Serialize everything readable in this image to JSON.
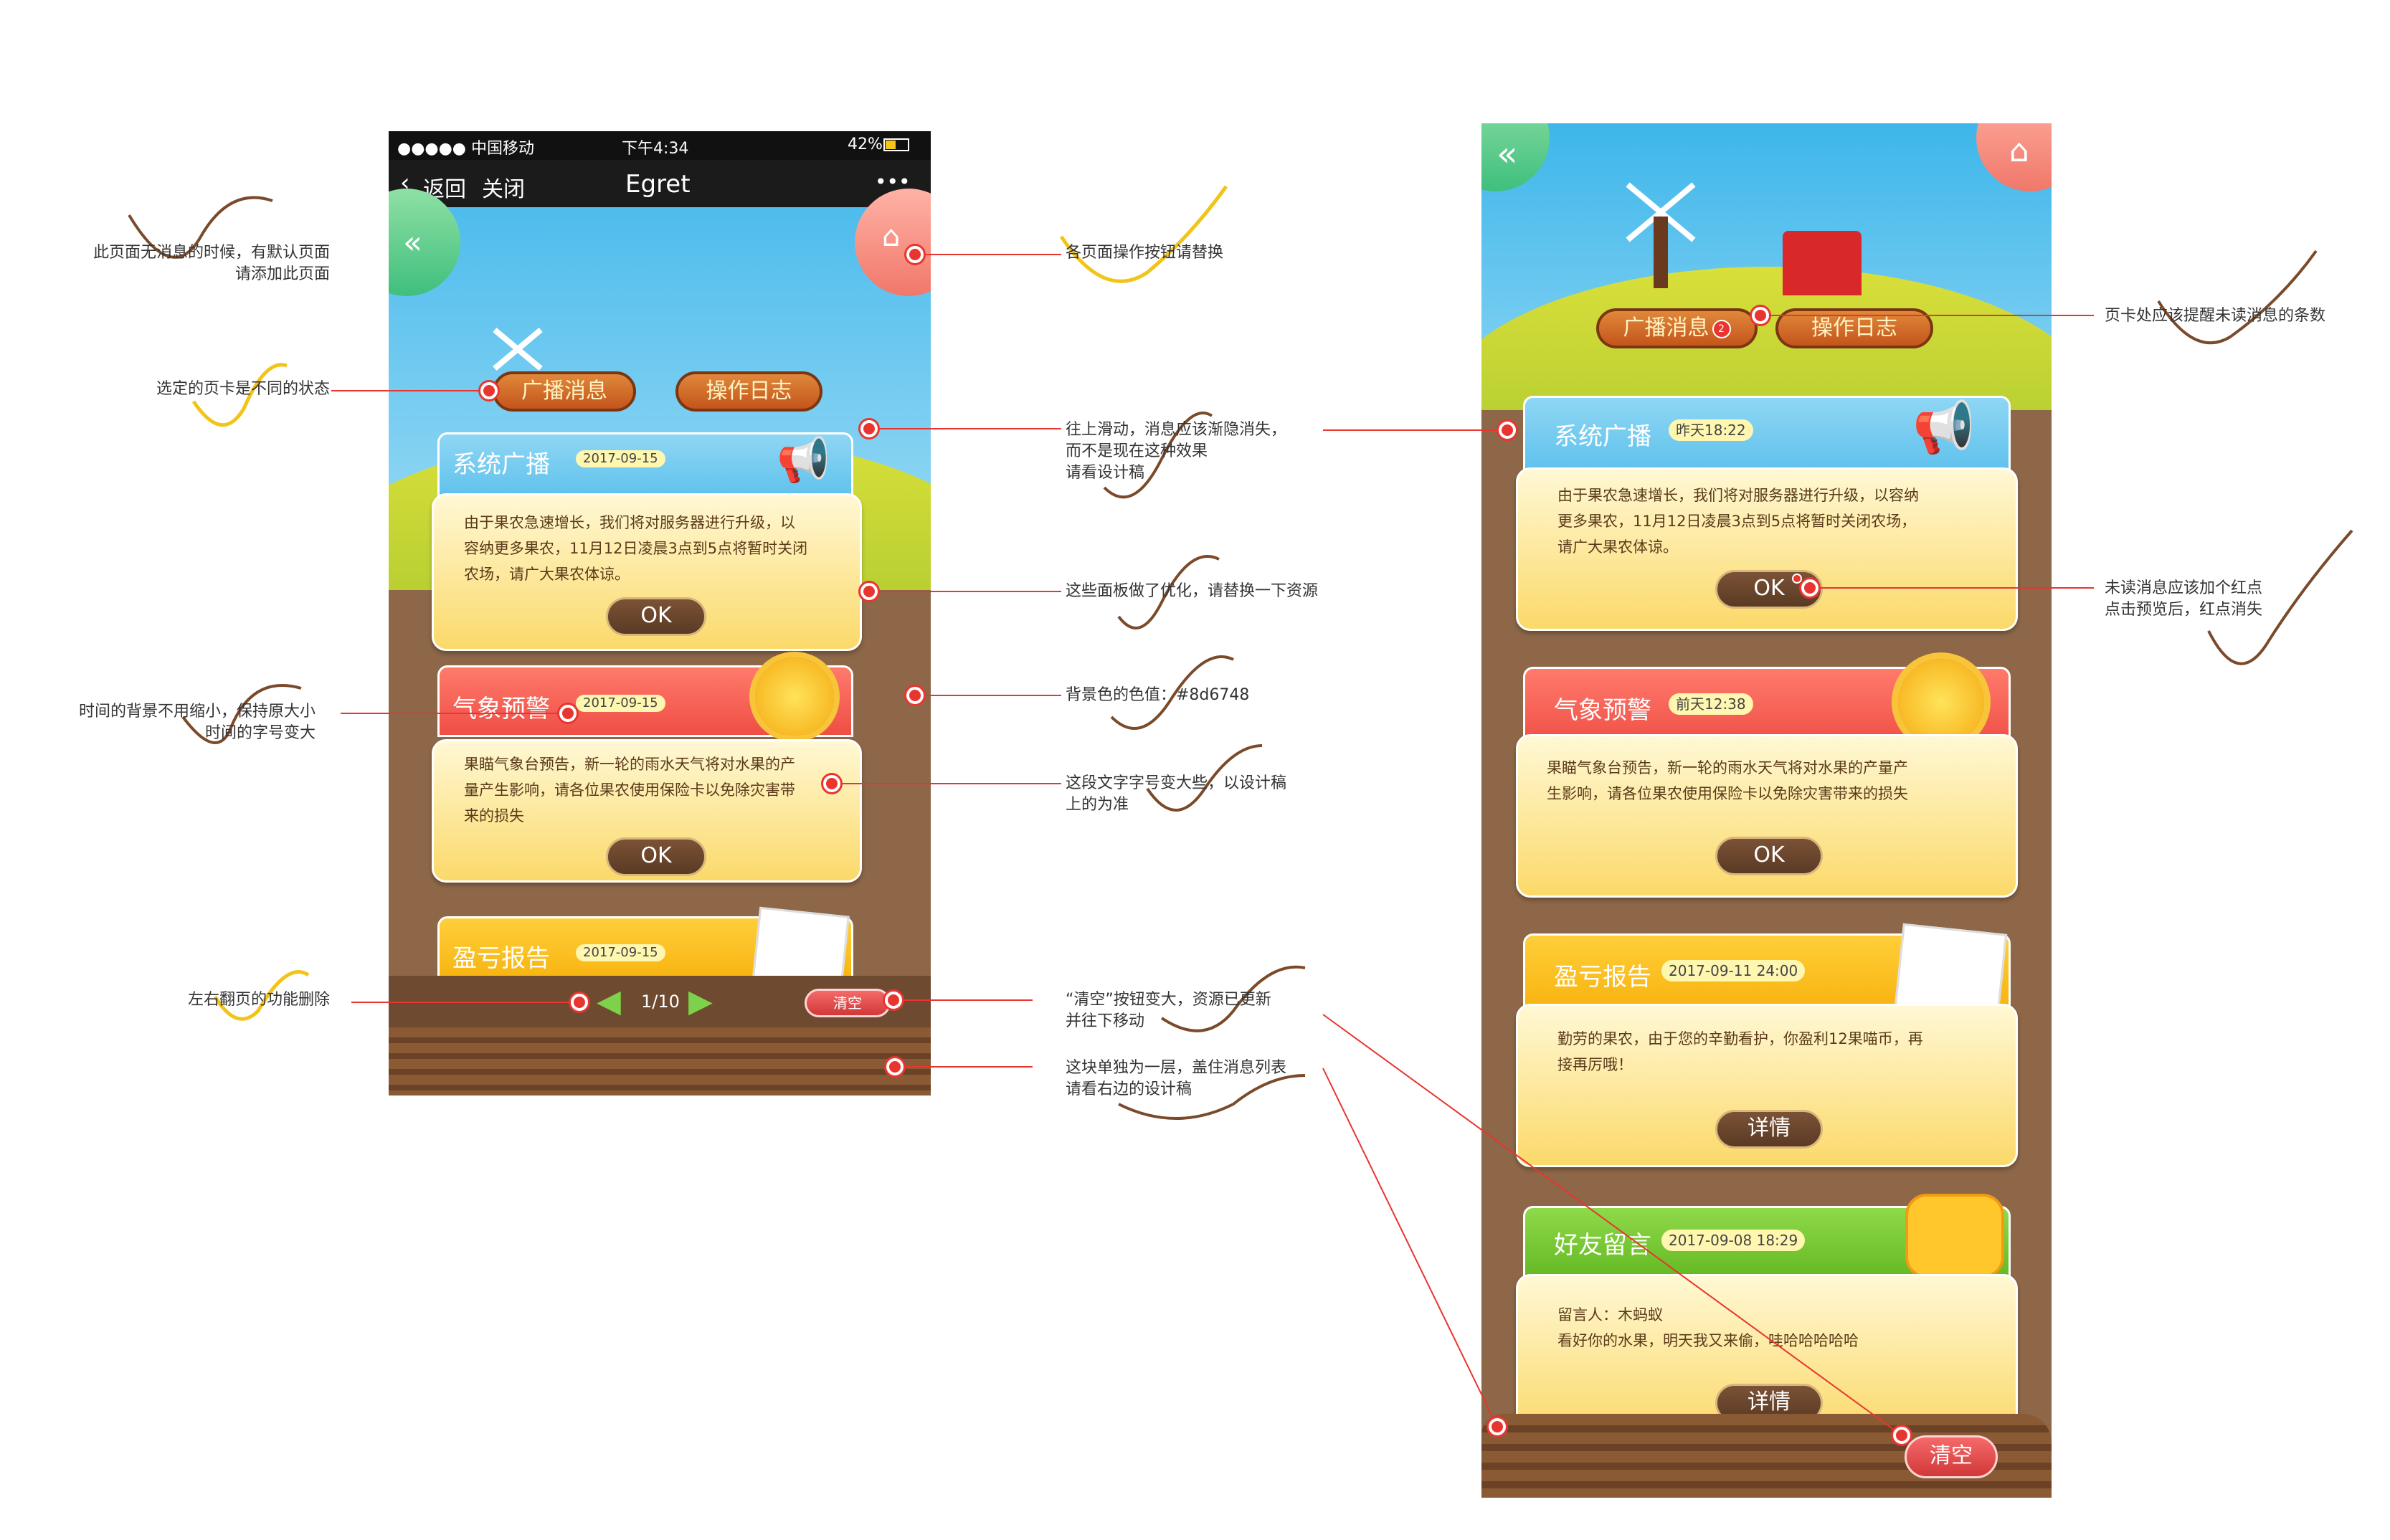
{
  "left_phone": {
    "status_bar": {
      "carrier": "●●●●● 中国移动",
      "time": "下午4:34",
      "battery": "42%"
    },
    "nav": {
      "back": "返回",
      "close": "关闭",
      "title": "Egret",
      "more": "•••"
    },
    "tabs": [
      "广播消息",
      "操作日志"
    ],
    "cards": [
      {
        "title": "系统广播",
        "time": "2017-09-15",
        "lines": [
          "由于果农急速增长，我们将对服务器进行升级，以",
          "容纳更多果农，11月12日凌晨3点到5点将暂时关闭",
          "农场，请广大果农体谅。"
        ],
        "button": "OK"
      },
      {
        "title": "气象预警",
        "time": "2017-09-15",
        "lines": [
          "果瞄气象台预告，新一轮的雨水天气将对水果的产",
          "量产生影响，请各位果农使用保险卡以免除灾害带",
          "来的损失"
        ],
        "button": "OK"
      },
      {
        "title": "盈亏报告",
        "time": "2017-09-15"
      }
    ],
    "pager": "1/10",
    "clear": "清空"
  },
  "right_phone": {
    "tabs": [
      "广播消息",
      "操作日志"
    ],
    "tab_badge": "2",
    "cards": [
      {
        "title": "系统广播",
        "time": "昨天18:22",
        "lines": [
          "由于果农急速增长，我们将对服务器进行升级，以容纳",
          "更多果农，11月12日凌晨3点到5点将暂时关闭农场，",
          "请广大果农体谅。"
        ],
        "button": "OK"
      },
      {
        "title": "气象预警",
        "time": "前天12:38",
        "lines": [
          "果瞄气象台预告，新一轮的雨水天气将对水果的产量产",
          "生影响，请各位果农使用保险卡以免除灾害带来的损失"
        ],
        "button": "OK"
      },
      {
        "title": "盈亏报告",
        "time": "2017-09-11 24:00",
        "lines": [
          "勤劳的果农，由于您的辛勤看护，你盈利12果喵币，再",
          "接再厉哦！"
        ],
        "button": "详情"
      },
      {
        "title": "好友留言",
        "time": "2017-09-08 18:29",
        "lines": [
          "留言人：木蚂蚁",
          "看好你的水果，明天我又来偷，哇哈哈哈哈哈"
        ],
        "button": "详情"
      }
    ],
    "clear": "清空"
  },
  "annotations": {
    "a1": [
      "此页面无消息的时候，有默认页面",
      "请添加此页面"
    ],
    "a2": "选定的页卡是不同的状态",
    "a3": [
      "时间的背景不用缩小，保持原大小",
      "时间的字号变大"
    ],
    "a4": "左右翻页的功能删除",
    "a5": "各页面操作按钮请替换",
    "a6": [
      "往上滑动，消息应该渐隐消失，",
      "而不是现在这种效果",
      "请看设计稿"
    ],
    "a7": "这些面板做了优化，请替换一下资源",
    "a8": "背景色的色值：#8d6748",
    "a9": [
      "这段文字字号变大些，以设计稿",
      "上的为准"
    ],
    "a10": [
      "“清空”按钮变大，资源已更新",
      "并往下移动"
    ],
    "a11": [
      "这块单独为一层，盖住消息列表",
      "请看右边的设计稿"
    ],
    "a12": "页卡处应该提醒未读消息的条数",
    "a13": [
      "未读消息应该加个红点",
      "点击预览后，红点消失"
    ]
  },
  "colors": {
    "ground": "#8d6748",
    "accent_red": "#e8352f"
  }
}
